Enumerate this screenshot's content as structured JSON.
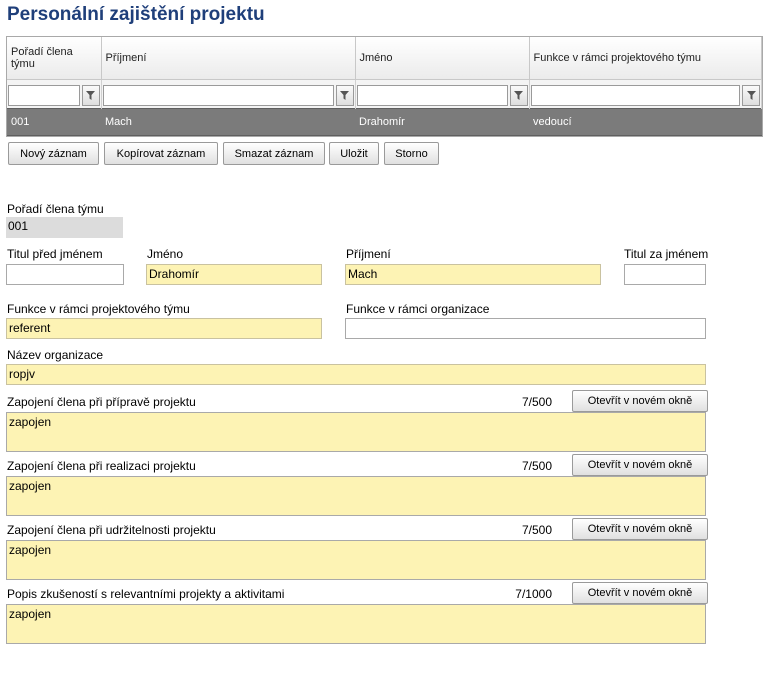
{
  "page_title": "Personální zajištění projektu",
  "grid": {
    "columns": [
      "Pořadí člena týmu",
      "Příjmení",
      "Jméno",
      "Funkce v rámci projektového týmu"
    ],
    "rows": [
      [
        "001",
        "Mach",
        "Drahomír",
        "vedoucí"
      ]
    ]
  },
  "toolbar": {
    "new": "Nový záznam",
    "copy": "Kopírovat záznam",
    "delete": "Smazat záznam",
    "save": "Uložit",
    "cancel": "Storno"
  },
  "form": {
    "order_label": "Pořadí člena týmu",
    "order_value": "001",
    "title_before_label": "Titul před jménem",
    "title_before_value": "",
    "first_name_label": "Jméno",
    "first_name_value": "Drahomír",
    "last_name_label": "Příjmení",
    "last_name_value": "Mach",
    "title_after_label": "Titul za jménem",
    "title_after_value": "",
    "team_function_label": "Funkce v rámci projektového týmu",
    "team_function_value": "referent",
    "org_function_label": "Funkce v rámci organizace",
    "org_function_value": "",
    "org_name_label": "Název organizace",
    "org_name_value": "ropjv",
    "open_window": "Otevřít v novém okně",
    "prep_label": "Zapojení člena při přípravě projektu",
    "prep_count": "7/500",
    "prep_value": "zapojen",
    "impl_label": "Zapojení člena při realizaci projektu",
    "impl_count": "7/500",
    "impl_value": "zapojen",
    "sust_label": "Zapojení člena při udržitelnosti projektu",
    "sust_count": "7/500",
    "sust_value": "zapojen",
    "exp_label": "Popis zkušeností s relevantními projekty a aktivitami",
    "exp_count": "7/1000",
    "exp_value": "zapojen"
  },
  "colors": {
    "title": "#1f3f7a",
    "selected_row": "#7b7b7b",
    "required_field": "#fdf3b4"
  }
}
